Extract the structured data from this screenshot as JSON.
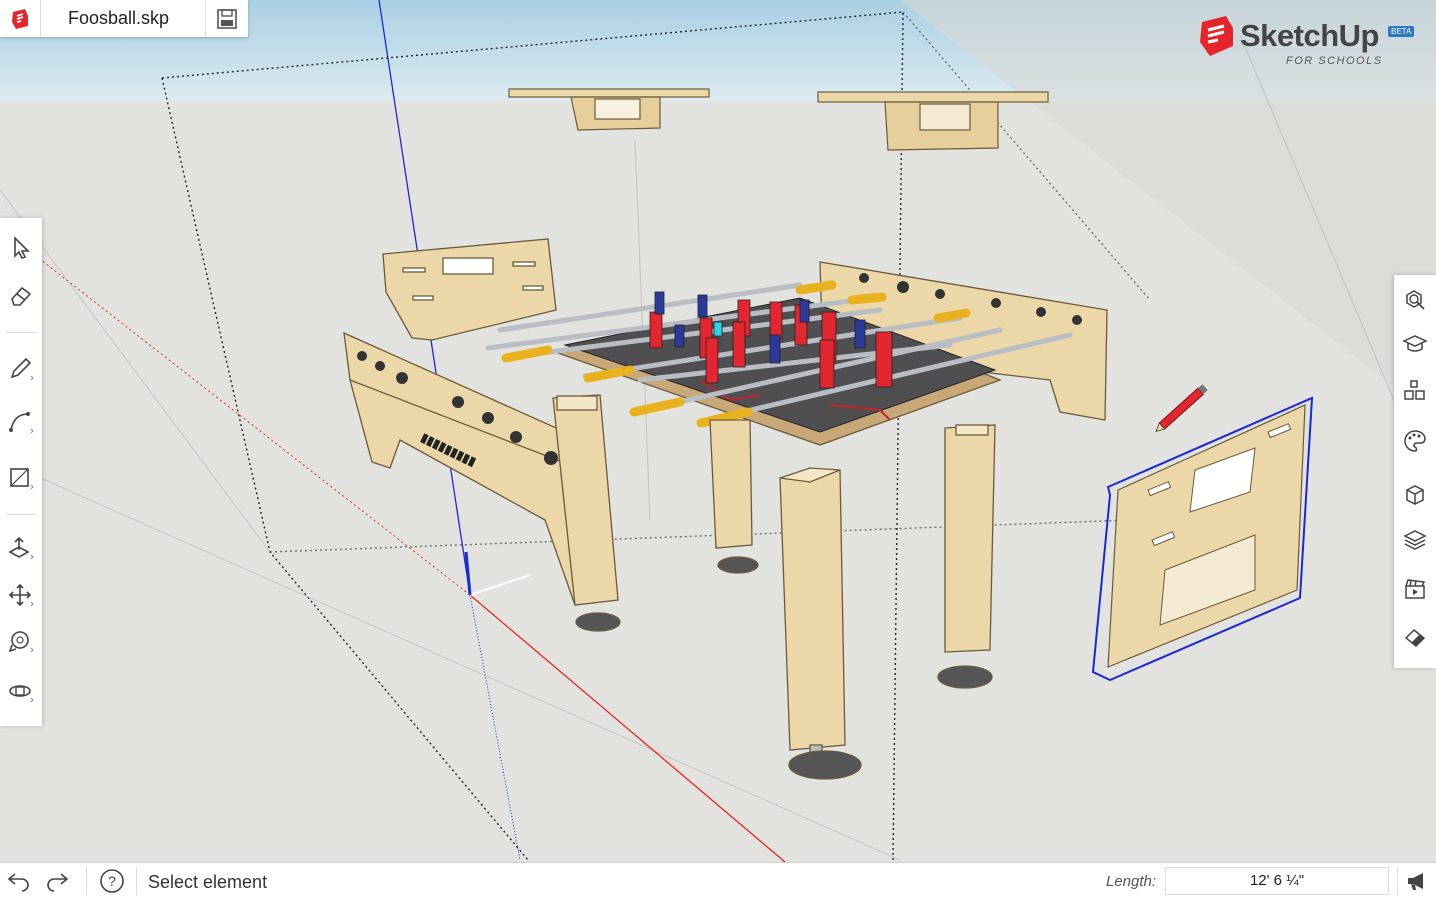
{
  "app": {
    "file_name": "Foosball.skp",
    "brand": "SketchUp",
    "brand_badge": "BETA",
    "brand_subtitle": "FOR SCHOOLS"
  },
  "left_toolbar": [
    {
      "name": "select-tool",
      "icon": "arrow-cursor-icon"
    },
    {
      "name": "eraser-tool",
      "icon": "eraser-icon"
    },
    {
      "name": "pencil-tool",
      "icon": "pencil-icon"
    },
    {
      "name": "arc-tool",
      "icon": "arc-icon"
    },
    {
      "name": "rectangle-tool",
      "icon": "rectangle-icon"
    },
    {
      "name": "push-pull-tool",
      "icon": "push-pull-icon"
    },
    {
      "name": "move-tool",
      "icon": "move-arrows-icon"
    },
    {
      "name": "tape-measure-tool",
      "icon": "tape-measure-icon"
    },
    {
      "name": "orbit-tool",
      "icon": "orbit-icon"
    }
  ],
  "right_toolbar": [
    {
      "name": "entity-info-panel",
      "icon": "magnifier-cube-icon"
    },
    {
      "name": "instructor-panel",
      "icon": "graduation-cap-icon"
    },
    {
      "name": "components-panel",
      "icon": "cubes-icon"
    },
    {
      "name": "materials-panel",
      "icon": "paint-palette-icon"
    },
    {
      "name": "styles-panel",
      "icon": "box-style-icon"
    },
    {
      "name": "layers-panel",
      "icon": "layers-icon"
    },
    {
      "name": "scenes-panel",
      "icon": "clapperboard-icon"
    },
    {
      "name": "display-panel",
      "icon": "eraser-display-icon"
    }
  ],
  "status_bar": {
    "status_text": "Select element",
    "length_label": "Length:",
    "length_value": "12' 6 ¼\""
  },
  "colors": {
    "sky": "#b7d6e6",
    "ground": "#e2e2df",
    "plywood": "#ecd7a8",
    "plywood_edge": "#b89c66",
    "selection_blue": "#1a28d8",
    "axis_red": "#e6261e",
    "axis_blue": "#1a2bd6",
    "brand_red": "#e4252b"
  }
}
